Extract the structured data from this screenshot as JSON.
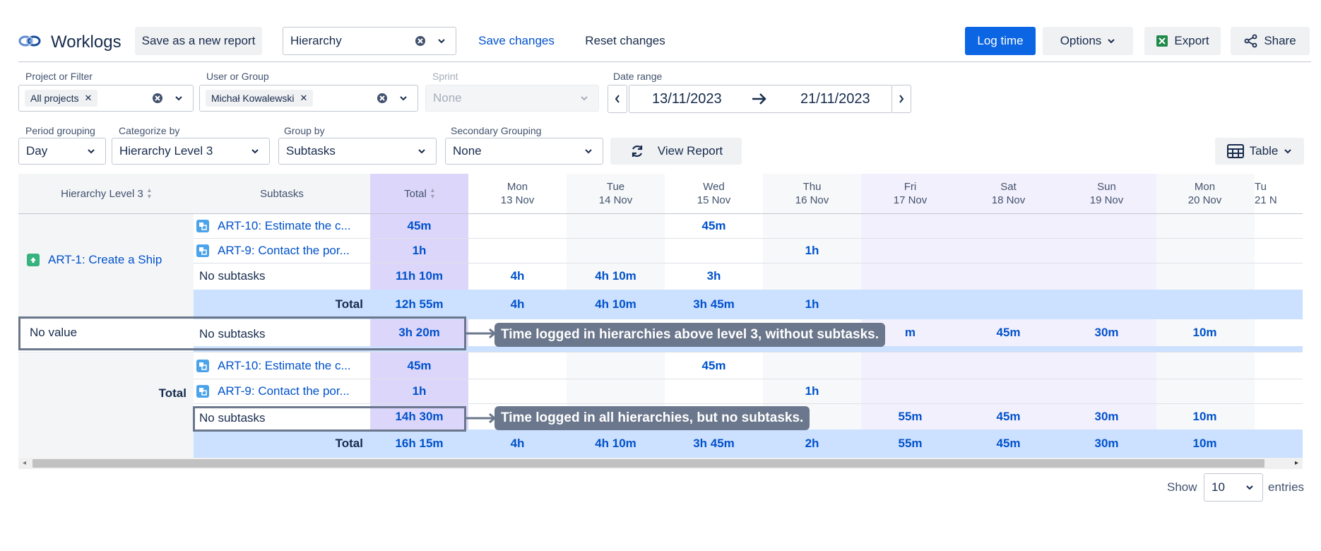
{
  "header": {
    "app_title": "Worklogs",
    "save_new_report": "Save as a new report",
    "report_select_value": "Hierarchy",
    "save_changes": "Save changes",
    "reset_changes": "Reset changes",
    "log_time": "Log time",
    "options": "Options",
    "export": "Export",
    "share": "Share"
  },
  "filters": {
    "project_label": "Project or Filter",
    "project_chip": "All projects",
    "user_label": "User or Group",
    "user_chip": "Michał Kowalewski",
    "sprint_label": "Sprint",
    "sprint_value": "None",
    "date_label": "Date range",
    "date_from": "13/11/2023",
    "date_to": "21/11/2023",
    "period_label": "Period grouping",
    "period_value": "Day",
    "categorize_label": "Categorize by",
    "categorize_value": "Hierarchy Level 3",
    "group_label": "Group by",
    "group_value": "Subtasks",
    "secondary_label": "Secondary Grouping",
    "secondary_value": "None",
    "view_report": "View Report",
    "table_view": "Table"
  },
  "table": {
    "col_hierarchy": "Hierarchy Level 3",
    "col_subtasks": "Subtasks",
    "col_total": "Total",
    "days": [
      {
        "dow": "Mon",
        "date": "13 Nov"
      },
      {
        "dow": "Tue",
        "date": "14 Nov"
      },
      {
        "dow": "Wed",
        "date": "15 Nov"
      },
      {
        "dow": "Thu",
        "date": "16 Nov"
      },
      {
        "dow": "Fri",
        "date": "17 Nov"
      },
      {
        "dow": "Sat",
        "date": "18 Nov"
      },
      {
        "dow": "Sun",
        "date": "19 Nov"
      },
      {
        "dow": "Mon",
        "date": "20 Nov"
      },
      {
        "dow": "Tu",
        "date": "21 N"
      }
    ],
    "group1_name": "ART-1: Create a Ship",
    "g1_sub1": "ART-10: Estimate the c...",
    "g1_sub1_total": "45m",
    "g1_sub1_wed": "45m",
    "g1_sub2": "ART-9: Contact the por...",
    "g1_sub2_total": "1h",
    "g1_sub2_thu": "1h",
    "g1_sub3": "No subtasks",
    "g1_sub3_total": "11h 10m",
    "g1_sub3_mon": "4h",
    "g1_sub3_tue": "4h 10m",
    "g1_sub3_wed": "3h",
    "g1_total_label": "Total",
    "g1_total": "12h 55m",
    "g1_total_mon": "4h",
    "g1_total_tue": "4h 10m",
    "g1_total_wed": "3h 45m",
    "g1_total_thu": "1h",
    "group2_name": "No value",
    "g2_sub": "No subtasks",
    "g2_total": "3h 20m",
    "g2_fri": "m",
    "g2_sat": "45m",
    "g2_sun": "30m",
    "g2_mon2": "10m",
    "group3_name": "Total",
    "g3_sub1": "ART-10: Estimate the c...",
    "g3_sub1_total": "45m",
    "g3_sub1_wed": "45m",
    "g3_sub2": "ART-9: Contact the por...",
    "g3_sub2_total": "1h",
    "g3_sub2_thu": "1h",
    "g3_sub3": "No subtasks",
    "g3_sub3_total": "14h 30m",
    "g3_sub3_fri": "55m",
    "g3_sub3_sat": "45m",
    "g3_sub3_sun": "30m",
    "g3_sub3_mon2": "10m",
    "grand_label": "Total",
    "grand_total": "16h 15m",
    "grand_mon": "4h",
    "grand_tue": "4h 10m",
    "grand_wed": "3h 45m",
    "grand_thu": "2h",
    "grand_fri": "55m",
    "grand_sat": "45m",
    "grand_sun": "30m",
    "grand_mon2": "10m"
  },
  "callouts": {
    "first": "Time logged in hierarchies above level 3, without subtasks.",
    "second": "Time logged in all hierarchies, but no subtasks."
  },
  "footer": {
    "show_label": "Show",
    "page_size": "10",
    "entries_label": "entries"
  },
  "colors": {
    "primary": "#0c66e4",
    "link": "#0052cc",
    "total_col": "#dcd6fb",
    "weekend": "#f3f0fd",
    "total_row": "#cce0ff",
    "callout": "#6b778c"
  }
}
